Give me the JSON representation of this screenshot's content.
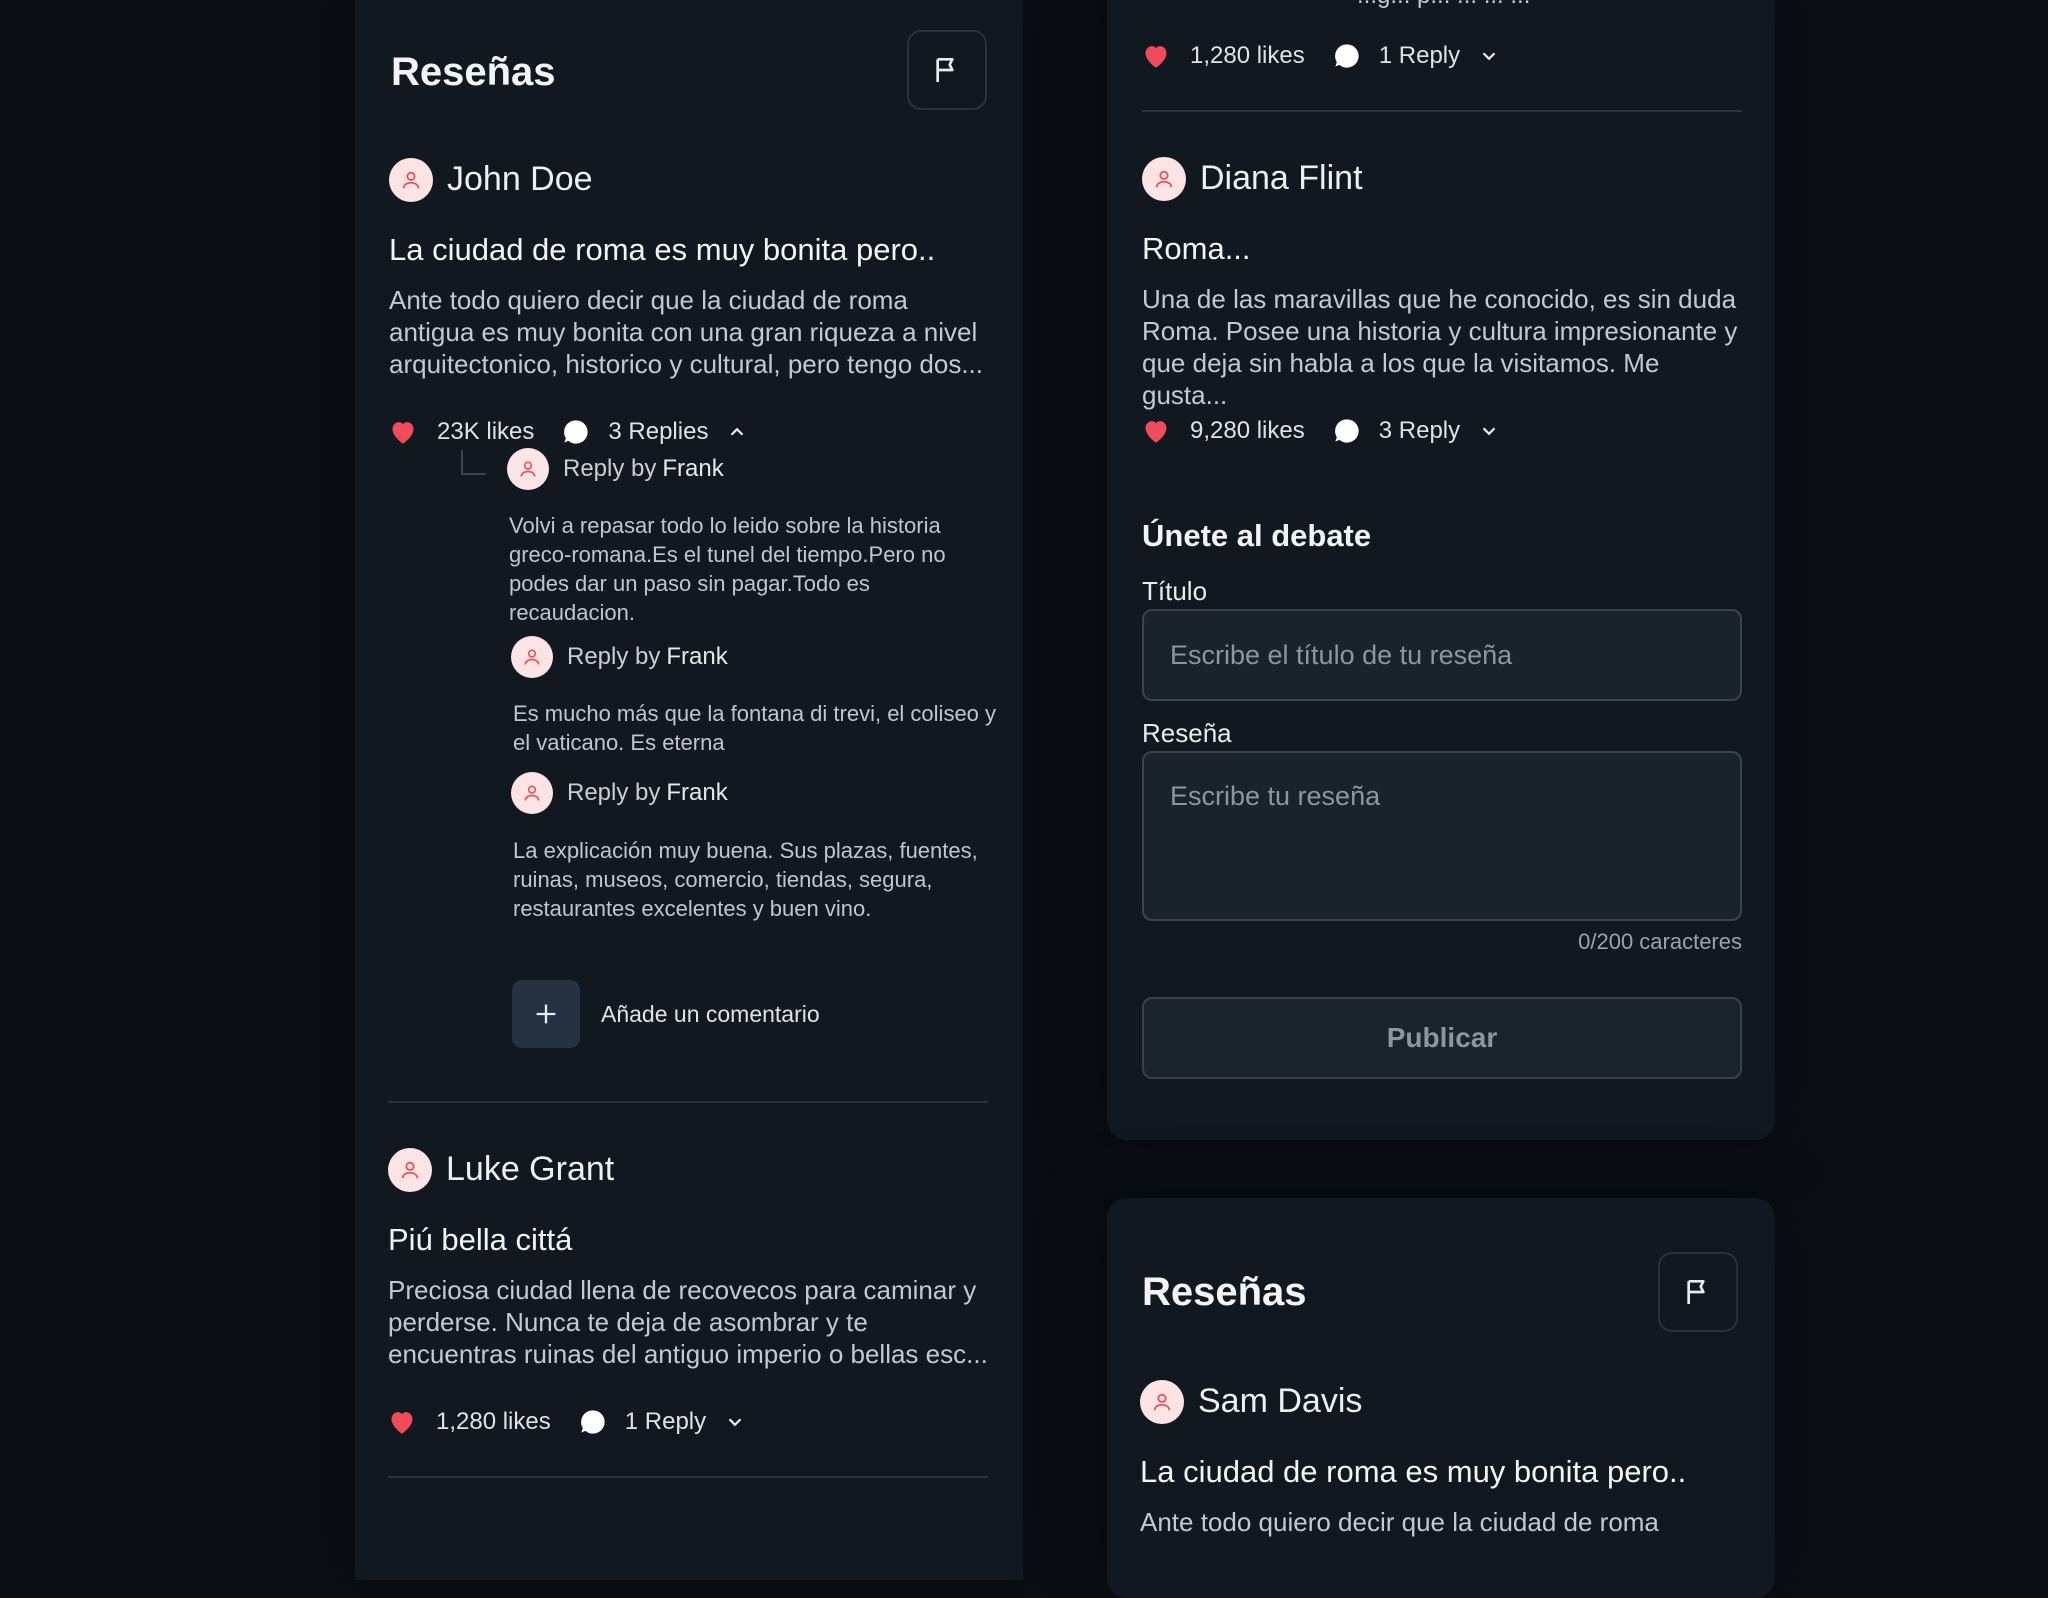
{
  "left_panel": {
    "title": "Reseñas",
    "review1": {
      "user": "John Doe",
      "title": "La ciudad de roma es muy bonita pero..",
      "body": "Ante todo quiero decir que la ciudad de roma antigua es muy bonita con una gran riqueza a nivel arquitectonico, historico y cultural, pero tengo dos...",
      "likes": "23K likes",
      "replies": "3 Replies",
      "replies_expanded": true,
      "reply_list": [
        {
          "prefix": "Reply by",
          "author": "Frank",
          "text": "Volvi a repasar todo lo leido sobre la historia greco-romana.Es el tunel del tiempo.Pero no podes dar un paso sin pagar.Todo es recaudacion."
        },
        {
          "prefix": "Reply by",
          "author": "Frank",
          "text": "Es mucho más que la fontana di trevi, el coliseo y el vaticano. Es eterna"
        },
        {
          "prefix": "Reply by",
          "author": "Frank",
          "text": "La explicación muy buena. Sus plazas, fuentes, ruinas, museos, comercio, tiendas, segura, restaurantes excelentes y buen vino."
        }
      ],
      "add_comment": "Añade un comentario"
    },
    "review2": {
      "user": "Luke Grant",
      "title": "Piú bella cittá",
      "body": "Preciosa ciudad llena de recovecos para caminar y perderse. Nunca te deja de asombrar y te encuentras ruinas del antiguo imperio o bellas esc...",
      "likes": "1,280 likes",
      "replies": "1 Reply"
    }
  },
  "right_top_panel": {
    "cut_text": "...g... p... ... ... ...",
    "prev_stats": {
      "likes": "1,280 likes",
      "replies": "1 Reply"
    },
    "review": {
      "user": "Diana Flint",
      "title": "Roma...",
      "body": "Una de las maravillas que he conocido, es sin duda Roma. Posee una historia y cultura impresionante y que deja sin habla a los que la visitamos. Me gusta...",
      "likes": "9,280 likes",
      "replies": "3 Reply"
    },
    "form": {
      "heading": "Únete al debate",
      "title_label": "Título",
      "title_placeholder": "Escribe el título de tu reseña",
      "review_label": "Reseña",
      "review_placeholder": "Escribe tu reseña",
      "char_count": "0/200 caracteres",
      "submit": "Publicar"
    }
  },
  "right_bottom_panel": {
    "title": "Reseñas",
    "review": {
      "user": "Sam Davis",
      "title": "La ciudad de roma es muy bonita pero..",
      "body": "Ante todo quiero decir que la ciudad de roma"
    }
  },
  "colors": {
    "background": "#0b0f15",
    "panel": "#111820",
    "heart": "#ef4b5a",
    "avatar_bg": "#fde4e4",
    "avatar_icon": "#e5535f",
    "button_disabled": "#1b232c"
  },
  "icons": [
    "flag-icon",
    "user-icon",
    "heart-icon",
    "chat-bubble-icon",
    "chevron-down-icon",
    "chevron-up-icon",
    "plus-icon",
    "reply-connector-icon"
  ]
}
